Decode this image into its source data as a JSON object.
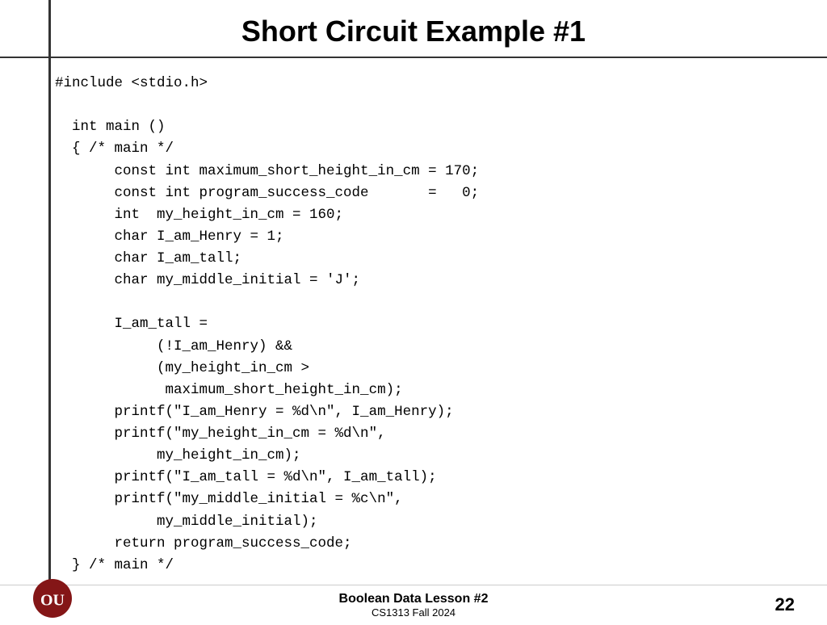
{
  "header": {
    "title": "Short Circuit Example #1"
  },
  "code": {
    "lines": "#include <stdio.h>\n\n  int main ()\n  { /* main */\n       const int maximum_short_height_in_cm = 170;\n       const int program_success_code       =   0;\n       int  my_height_in_cm = 160;\n       char I_am_Henry = 1;\n       char I_am_tall;\n       char my_middle_initial = 'J';\n\n       I_am_tall =\n            (!I_am_Henry) &&\n            (my_height_in_cm >\n             maximum_short_height_in_cm);\n       printf(\"I_am_Henry = %d\\n\", I_am_Henry);\n       printf(\"my_height_in_cm = %d\\n\",\n            my_height_in_cm);\n       printf(\"I_am_tall = %d\\n\", I_am_tall);\n       printf(\"my_middle_initial = %c\\n\",\n            my_middle_initial);\n       return program_success_code;\n  } /* main */"
  },
  "footer": {
    "lesson_title": "Boolean Data Lesson #2",
    "course": "CS1313 Fall 2024",
    "page_number": "22"
  }
}
